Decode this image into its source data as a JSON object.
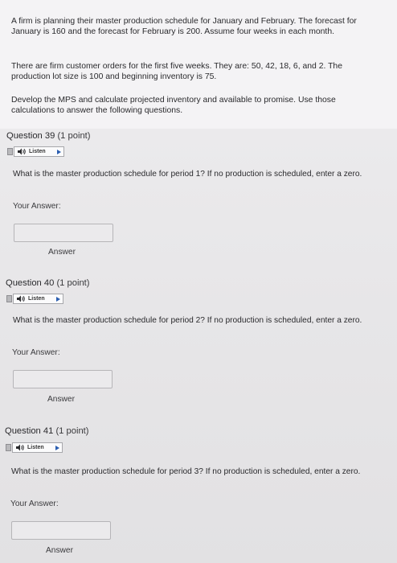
{
  "intro": {
    "paragraph1": "A firm is planning their master production schedule for January and February. The forecast for January is 160 and the forecast for February is 200. Assume four weeks in each month.",
    "paragraph2": "There are firm customer orders for the first five weeks. They are: 50, 42, 18, 6, and 2. The production lot size is 100 and beginning inventory is 75.",
    "paragraph3": "Develop the MPS and calculate projected inventory and available to promise. Use those calculations to answer the following questions."
  },
  "questions": [
    {
      "title": "Question 39",
      "points": "(1 point)",
      "listen_label": "Listen",
      "text": "What is the master production schedule for period 1? If no production is scheduled, enter a zero.",
      "your_answer_label": "Your Answer:",
      "answer_value": "",
      "answer_label": "Answer"
    },
    {
      "title": "Question 40",
      "points": "(1 point)",
      "listen_label": "Listen",
      "text": "What is the master production schedule for period 2? If no production is scheduled, enter a zero.",
      "your_answer_label": "Your Answer:",
      "answer_value": "",
      "answer_label": "Answer"
    },
    {
      "title": "Question 41",
      "points": "(1 point)",
      "listen_label": "Listen",
      "text": "What is the master production schedule for period 3? If no production is scheduled, enter a zero.",
      "your_answer_label": "Your Answer:",
      "answer_value": "",
      "answer_label": "Answer"
    }
  ],
  "colors": {
    "accent": "#2a5db0",
    "text": "#2a2a2d",
    "background": "#e9e8ea"
  },
  "icons": {
    "listen": "speaker-icon",
    "play": "play-icon"
  }
}
